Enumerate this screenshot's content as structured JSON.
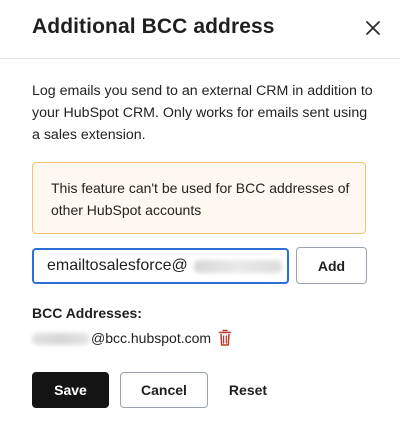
{
  "dialog": {
    "title": "Additional BCC address",
    "close_icon": "close-icon",
    "description": "Log emails you send to an external CRM in addition to your HubSpot CRM. Only works for emails sent using a sales extension.",
    "alert_text": "This feature can't be used for BCC addresses of other HubSpot accounts",
    "alert_colors": {
      "background": "#fef8f0",
      "border": "#f5c26b"
    }
  },
  "email_input": {
    "value_visible": "emailtosalesforce@",
    "redacted": true,
    "focus_color": "#2d6fd6"
  },
  "add_button": {
    "label": "Add"
  },
  "bcc_list": {
    "label": "BCC Addresses:",
    "items": [
      {
        "address_visible": "@bcc.hubspot.com",
        "redacted_prefix": true,
        "icon": "trash-icon",
        "icon_color": "#c0392b"
      }
    ]
  },
  "footer": {
    "save_label": "Save",
    "cancel_label": "Cancel",
    "reset_label": "Reset"
  }
}
